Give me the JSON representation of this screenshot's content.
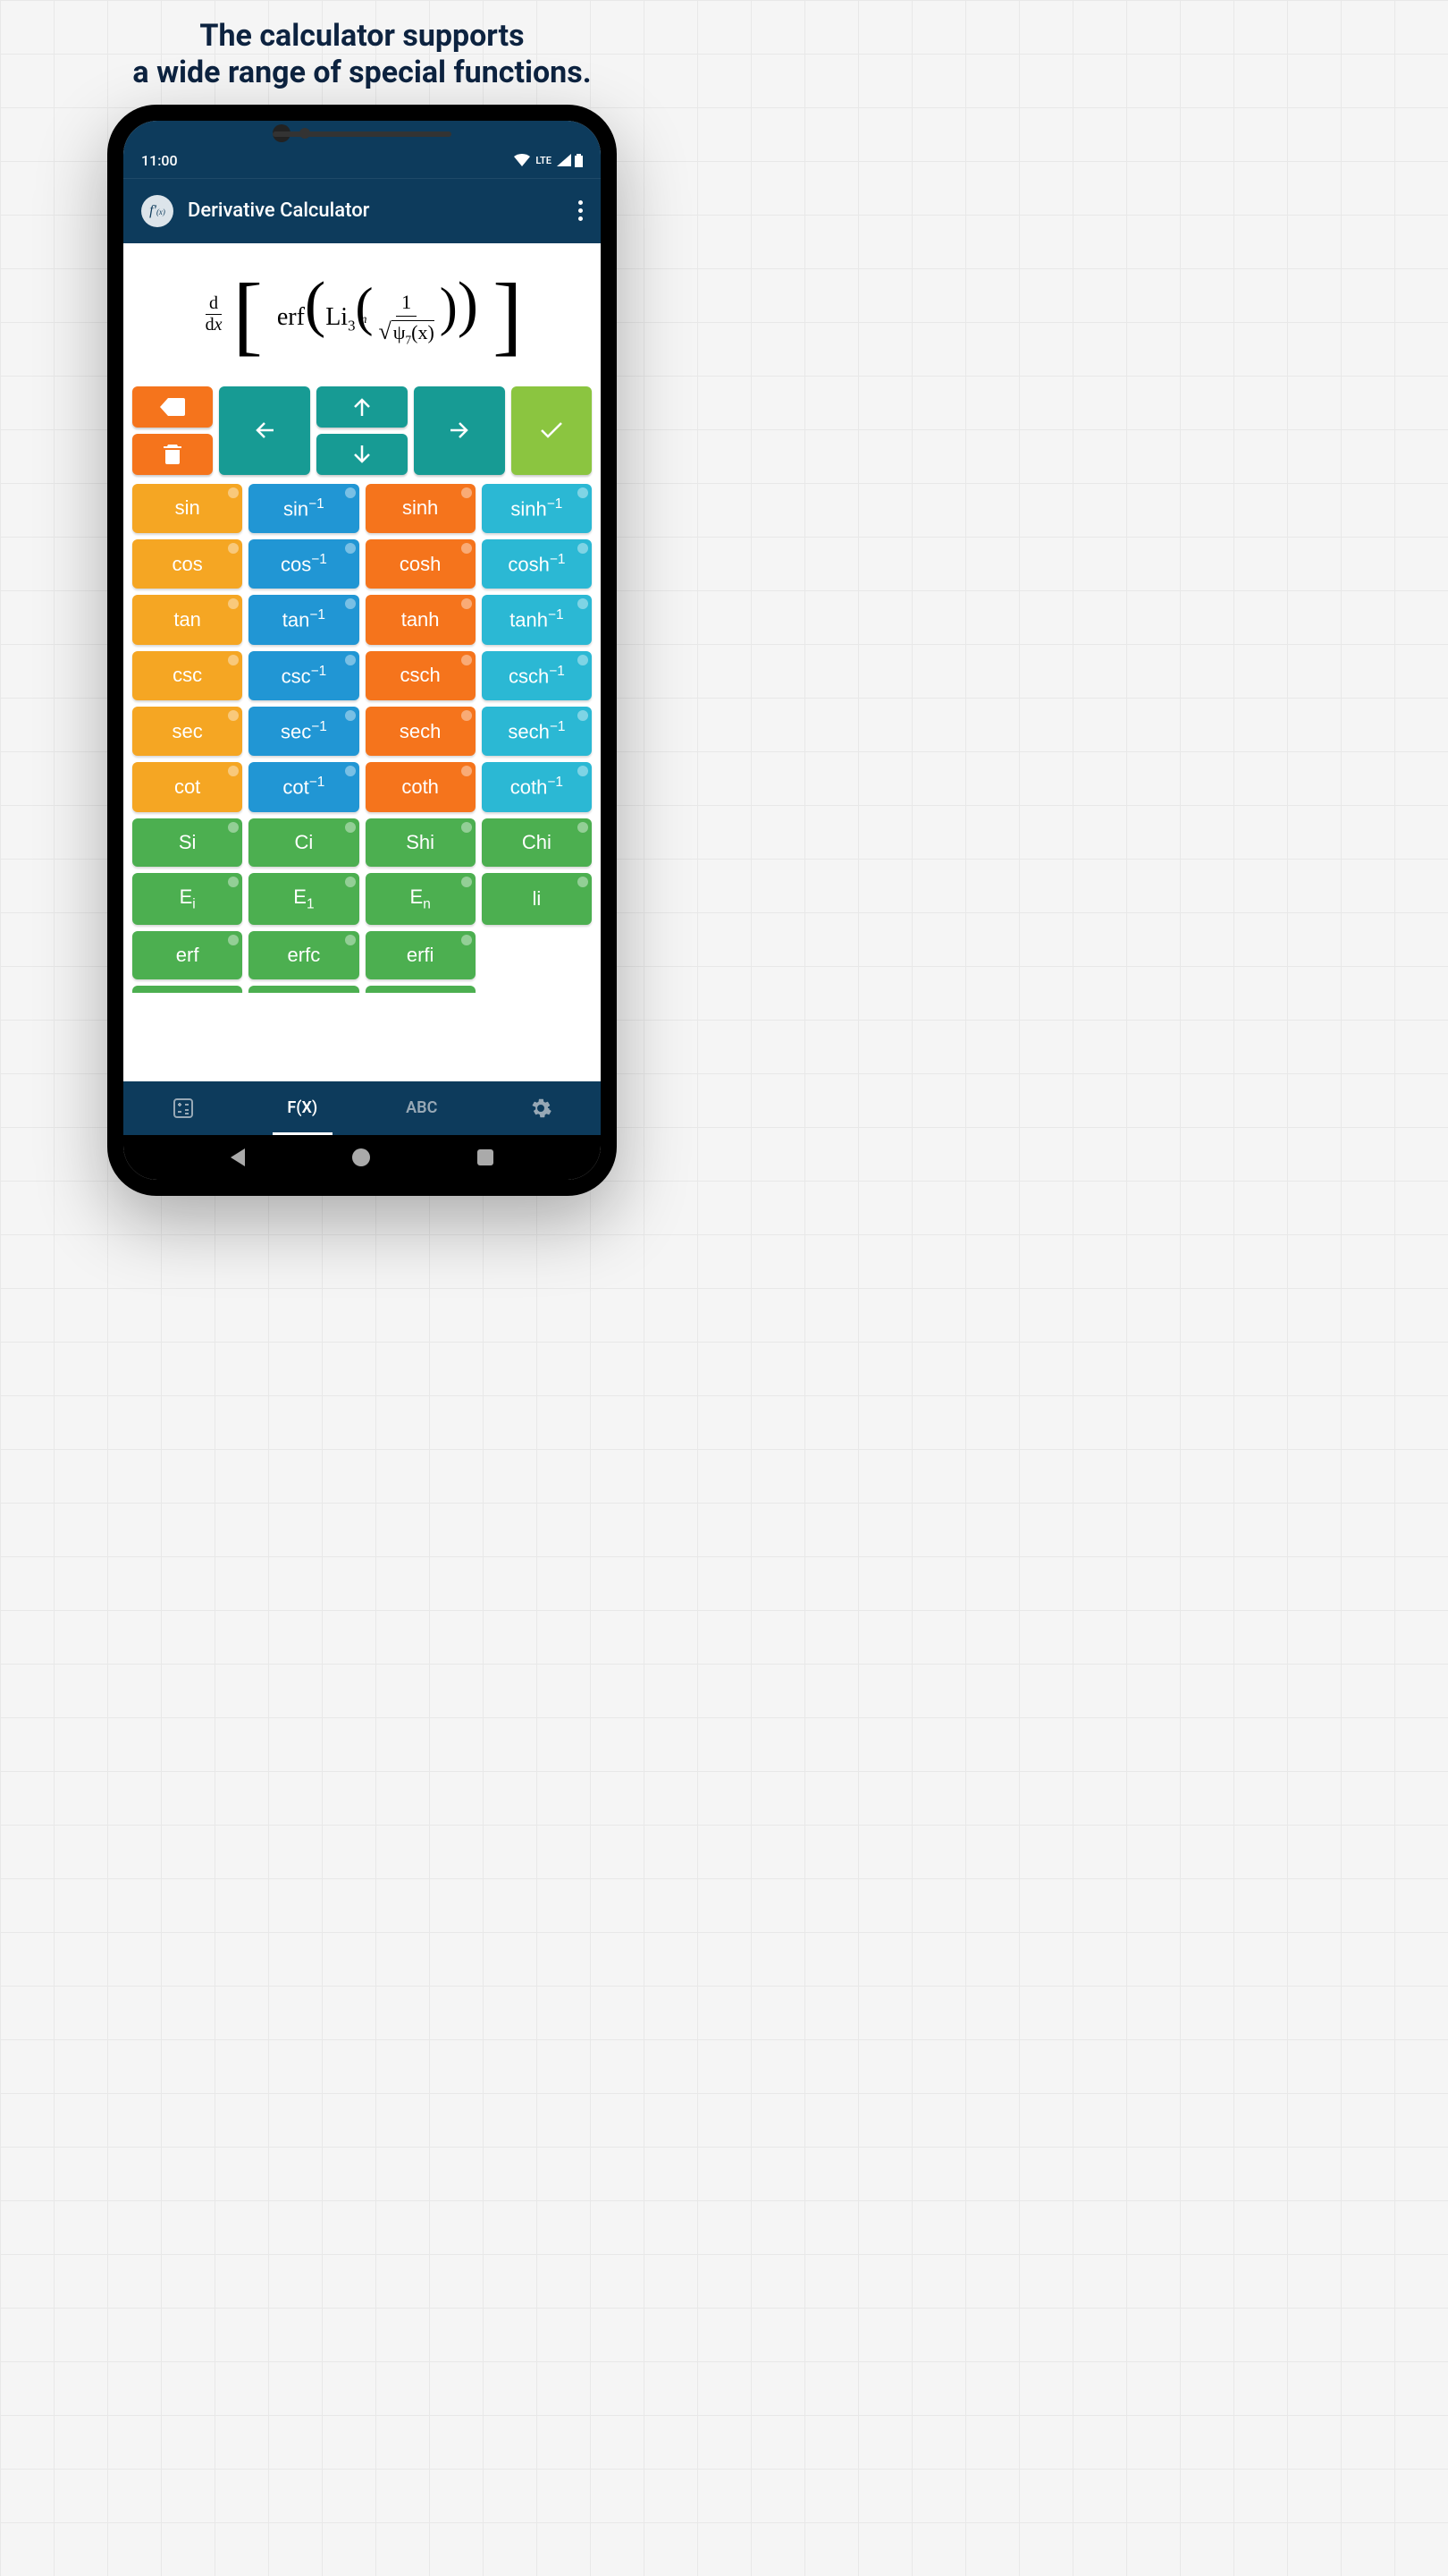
{
  "headline_line1": "The calculator supports",
  "headline_line2": "a wide range of special functions.",
  "status": {
    "time": "11:00",
    "network": "LTE"
  },
  "app": {
    "title": "Derivative Calculator",
    "logo_text": "f'(x)"
  },
  "formula": {
    "deriv_num": "d",
    "deriv_den": "dx",
    "erf": "erf",
    "li": "Li",
    "li_sub": "3",
    "frac_num": "1",
    "root_index": "n",
    "psi": "ψ",
    "psi_sub": "7",
    "psi_arg": "(x)"
  },
  "fn_rows": [
    [
      {
        "label": "sin",
        "sup": "",
        "sub": "",
        "color": "c-amber"
      },
      {
        "label": "sin",
        "sup": "−1",
        "sub": "",
        "color": "c-blue"
      },
      {
        "label": "sinh",
        "sup": "",
        "sub": "",
        "color": "c-orange"
      },
      {
        "label": "sinh",
        "sup": "−1",
        "sub": "",
        "color": "c-cyan"
      }
    ],
    [
      {
        "label": "cos",
        "sup": "",
        "sub": "",
        "color": "c-amber"
      },
      {
        "label": "cos",
        "sup": "−1",
        "sub": "",
        "color": "c-blue"
      },
      {
        "label": "cosh",
        "sup": "",
        "sub": "",
        "color": "c-orange"
      },
      {
        "label": "cosh",
        "sup": "−1",
        "sub": "",
        "color": "c-cyan"
      }
    ],
    [
      {
        "label": "tan",
        "sup": "",
        "sub": "",
        "color": "c-amber"
      },
      {
        "label": "tan",
        "sup": "−1",
        "sub": "",
        "color": "c-blue"
      },
      {
        "label": "tanh",
        "sup": "",
        "sub": "",
        "color": "c-orange"
      },
      {
        "label": "tanh",
        "sup": "−1",
        "sub": "",
        "color": "c-cyan"
      }
    ],
    [
      {
        "label": "csc",
        "sup": "",
        "sub": "",
        "color": "c-amber"
      },
      {
        "label": "csc",
        "sup": "−1",
        "sub": "",
        "color": "c-blue"
      },
      {
        "label": "csch",
        "sup": "",
        "sub": "",
        "color": "c-orange"
      },
      {
        "label": "csch",
        "sup": "−1",
        "sub": "",
        "color": "c-cyan"
      }
    ],
    [
      {
        "label": "sec",
        "sup": "",
        "sub": "",
        "color": "c-amber"
      },
      {
        "label": "sec",
        "sup": "−1",
        "sub": "",
        "color": "c-blue"
      },
      {
        "label": "sech",
        "sup": "",
        "sub": "",
        "color": "c-orange"
      },
      {
        "label": "sech",
        "sup": "−1",
        "sub": "",
        "color": "c-cyan"
      }
    ],
    [
      {
        "label": "cot",
        "sup": "",
        "sub": "",
        "color": "c-amber"
      },
      {
        "label": "cot",
        "sup": "−1",
        "sub": "",
        "color": "c-blue"
      },
      {
        "label": "coth",
        "sup": "",
        "sub": "",
        "color": "c-orange"
      },
      {
        "label": "coth",
        "sup": "−1",
        "sub": "",
        "color": "c-cyan"
      }
    ],
    [
      {
        "label": "Si",
        "sup": "",
        "sub": "",
        "color": "c-green"
      },
      {
        "label": "Ci",
        "sup": "",
        "sub": "",
        "color": "c-green"
      },
      {
        "label": "Shi",
        "sup": "",
        "sub": "",
        "color": "c-green"
      },
      {
        "label": "Chi",
        "sup": "",
        "sub": "",
        "color": "c-green"
      }
    ],
    [
      {
        "label": "E",
        "sup": "",
        "sub": "i",
        "color": "c-green"
      },
      {
        "label": "E",
        "sup": "",
        "sub": "1",
        "color": "c-green"
      },
      {
        "label": "E",
        "sup": "",
        "sub": "n",
        "color": "c-green"
      },
      {
        "label": "li",
        "sup": "",
        "sub": "",
        "color": "c-green"
      }
    ],
    [
      {
        "label": "erf",
        "sup": "",
        "sub": "",
        "color": "c-green"
      },
      {
        "label": "erfc",
        "sup": "",
        "sub": "",
        "color": "c-green"
      },
      {
        "label": "erfi",
        "sup": "",
        "sub": "",
        "color": "c-green"
      }
    ]
  ],
  "bottom_nav": {
    "tab_fx": "F(X)",
    "tab_abc": "ABC"
  }
}
